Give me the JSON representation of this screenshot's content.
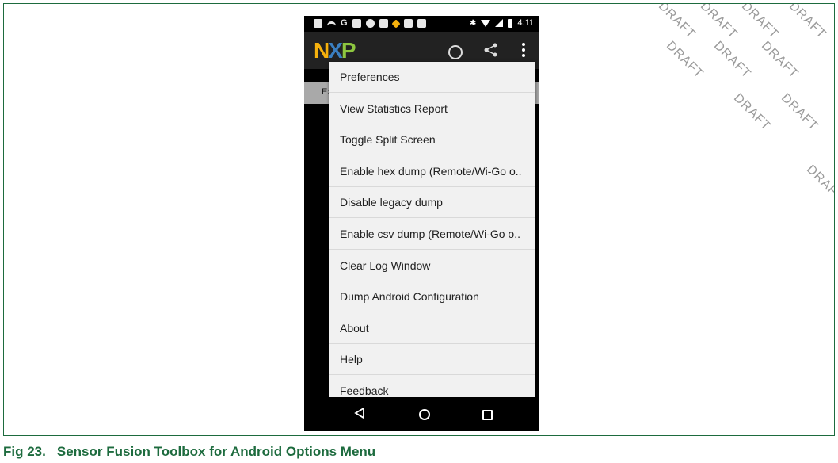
{
  "status_bar": {
    "time": "4:11",
    "left_icons": [
      "message-icon",
      "phone-icon",
      "g-icon",
      "linkedin-icon",
      "chat-icon",
      "linkedin-icon",
      "diamond-icon",
      "mail-icon",
      "linkedin-icon"
    ],
    "right_icons": [
      "bluetooth-icon",
      "wifi-icon",
      "signal-icon",
      "battery-icon"
    ]
  },
  "app_bar": {
    "logo": {
      "n": "N",
      "x": "X",
      "p": "P"
    },
    "actions": [
      "chevron-circle-icon",
      "share-icon",
      "overflow-menu-icon"
    ]
  },
  "behind_menu": {
    "tab_text": "Ex"
  },
  "menu": {
    "items": [
      {
        "label": "Preferences"
      },
      {
        "label": "View Statistics Report"
      },
      {
        "label": "Toggle Split Screen"
      },
      {
        "label": "Enable hex dump (Remote/Wi-Go o.."
      },
      {
        "label": "Disable legacy dump"
      },
      {
        "label": "Enable csv dump (Remote/Wi-Go o.."
      },
      {
        "label": "Clear Log Window"
      },
      {
        "label": "Dump Android Configuration"
      },
      {
        "label": "About"
      },
      {
        "label": "Help"
      },
      {
        "label": "Feedback"
      }
    ]
  },
  "nav_bar": {
    "buttons": [
      "back-icon",
      "home-icon",
      "recents-icon"
    ]
  },
  "watermark": {
    "text": "DRAFT"
  },
  "caption": {
    "number": "Fig 23.",
    "title": "Sensor Fusion Toolbox for Android Options Menu"
  },
  "colors": {
    "frame_border": "#1d6b3e",
    "caption": "#1d6b3e",
    "menu_bg": "#f1f1f1",
    "app_bar_bg": "#222222",
    "logo_n": "#f6b10d",
    "logo_x": "#3a7fc1",
    "logo_p": "#8dc63f"
  }
}
